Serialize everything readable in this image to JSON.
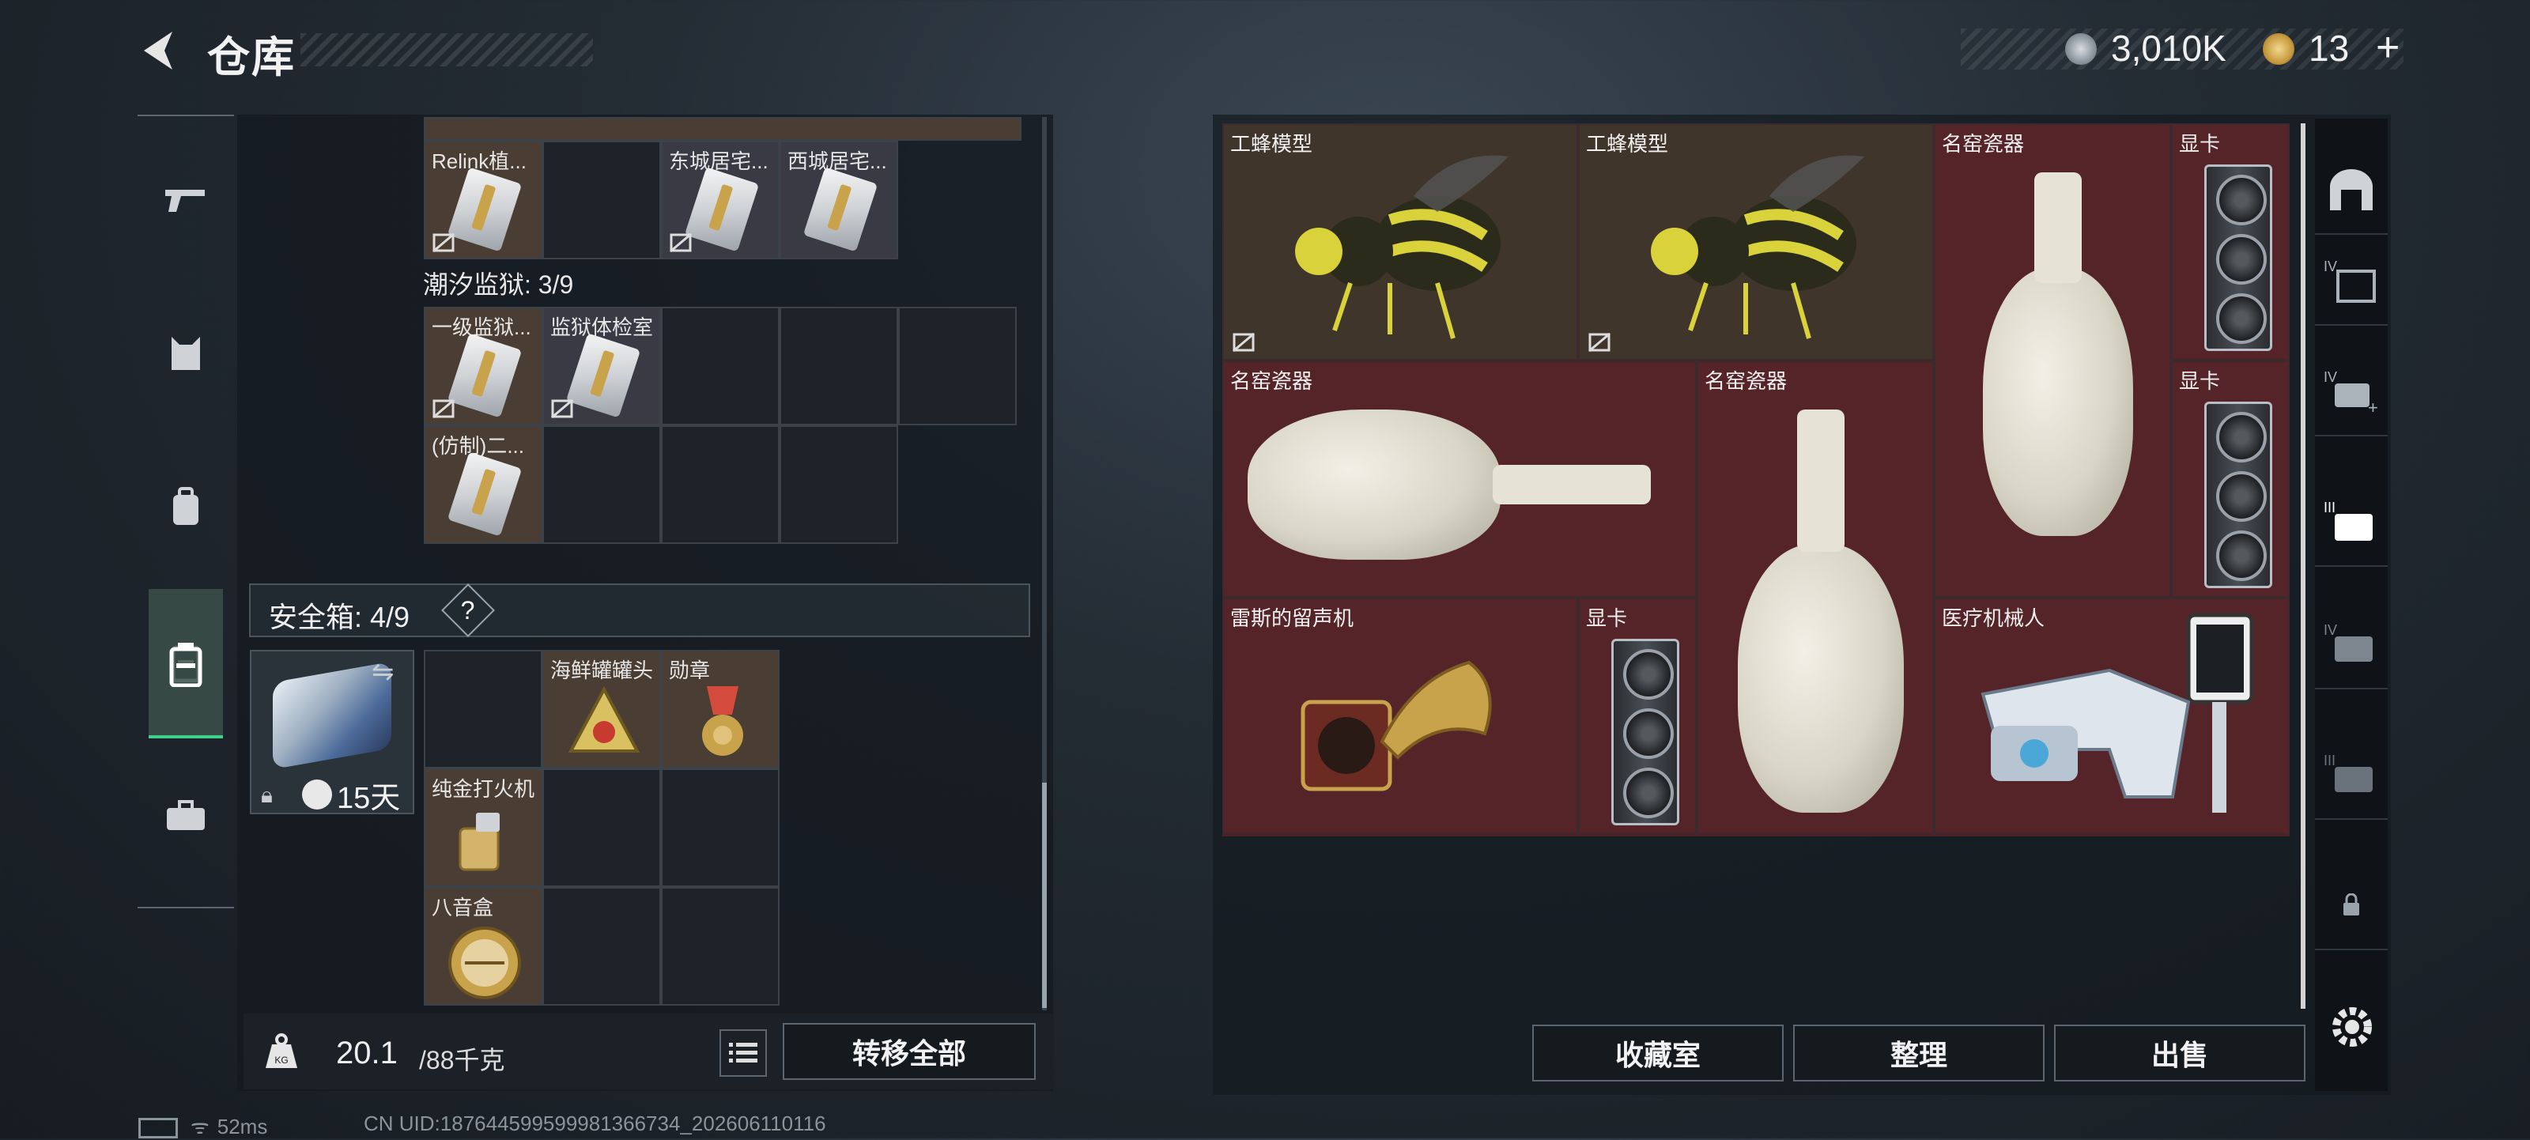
{
  "header": {
    "title": "仓库"
  },
  "currency": {
    "money": "3,010K",
    "gold": "13",
    "plus": "+"
  },
  "left_nav": {
    "icons": [
      "gun-icon",
      "armor-icon",
      "backpack-icon",
      "storage-icon",
      "toolbox-icon"
    ]
  },
  "warehouse": {
    "top_row_items": [
      "Relink植...",
      "东城居宅...",
      "西城居宅..."
    ],
    "prison": {
      "label": "潮汐监狱: 3/9",
      "items": [
        "一级监狱...",
        "监狱体检室",
        "(仿制)二..."
      ]
    }
  },
  "safe": {
    "title": "安全箱: 4/9",
    "help": "?",
    "duration": "15天",
    "items": [
      "海鲜罐罐头",
      "勋章",
      "纯金打火机",
      "八音盒"
    ]
  },
  "weight": {
    "current": "20.1",
    "max": "/88千克"
  },
  "buttons": {
    "transfer_all": "转移全部",
    "collection": "收藏室",
    "organize": "整理",
    "sell": "出售"
  },
  "grid_items": {
    "bee1": "工蜂模型",
    "bee2": "工蜂模型",
    "vase_top": "名窑瓷器",
    "gpu1": "显卡",
    "vase_left": "名窑瓷器",
    "vase_mid": "名窑瓷器",
    "gpu2": "显卡",
    "phono": "雷斯的留声机",
    "gpu3": "显卡",
    "robot": "医疗机械人"
  },
  "status": {
    "ping": "52ms",
    "uid": "CN UID:187644599599981366734_202606110116"
  }
}
